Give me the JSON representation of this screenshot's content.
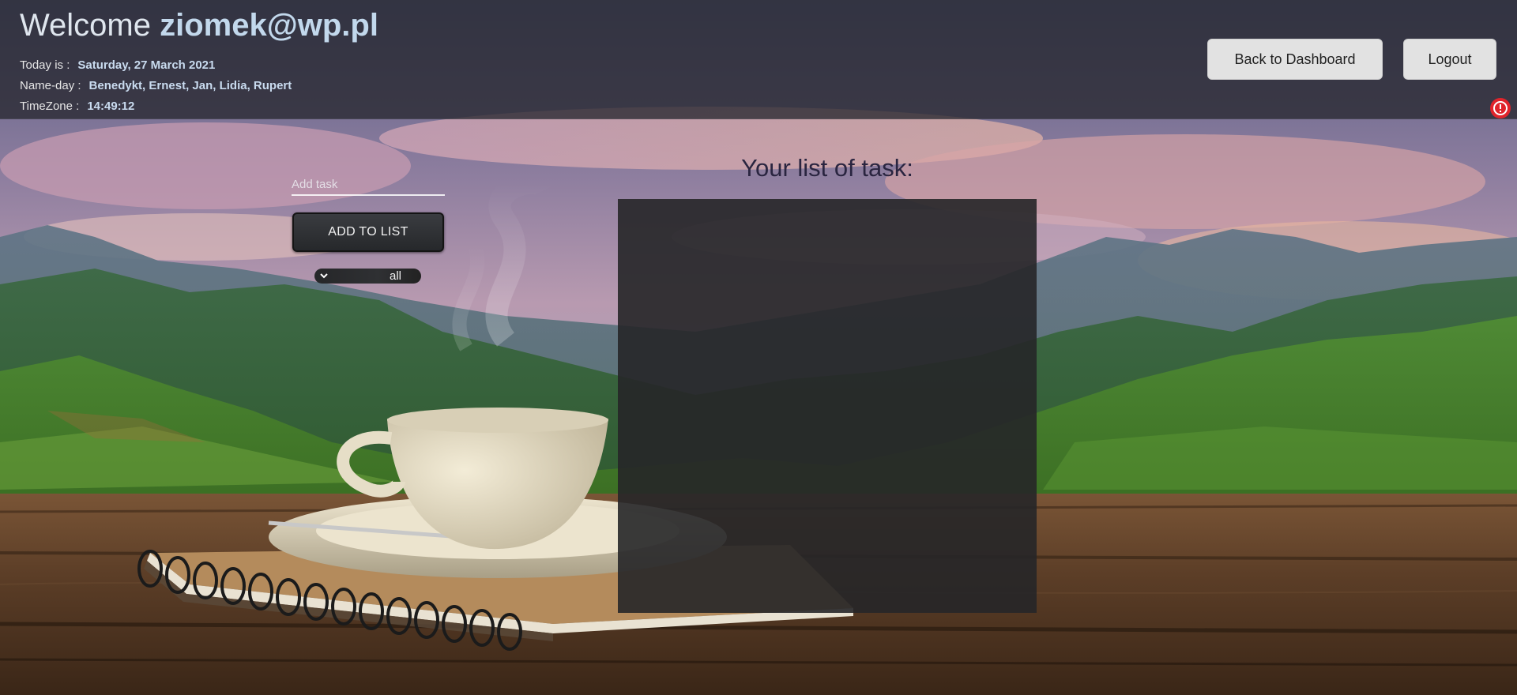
{
  "header": {
    "welcome_prefix": "Welcome",
    "user_email": "ziomek@wp.pl",
    "date_label": "Today is :",
    "date_value": "Saturday, 27 March 2021",
    "nameday_label": "Name-day :",
    "nameday_value": "Benedykt, Ernest, Jan, Lidia, Rupert",
    "timezone_label": "TimeZone :",
    "timezone_value": "14:49:12",
    "dashboard_button": "Back to Dashboard",
    "logout_button": "Logout"
  },
  "task_form": {
    "input_placeholder": "Add task",
    "input_value": "",
    "add_button": "ADD TO LIST",
    "filter_value": "all"
  },
  "task_list": {
    "title": "Your list of task:",
    "items": []
  },
  "icons": {
    "alert": "alert-icon",
    "filter_chevron": "chevron-down-icon"
  },
  "colors": {
    "header_bg": "#28283099",
    "user_email": "#c2d8ec",
    "alert": "#e0242b",
    "panel_bg": "#262628",
    "button_bg": "#e2e2e2"
  }
}
